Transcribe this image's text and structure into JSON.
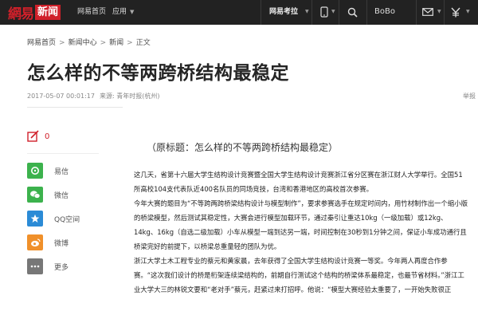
{
  "topbar": {
    "logo_mark": "網易",
    "logo_news": "新闻",
    "nav_home": "网易首页",
    "nav_apps": "应用",
    "kaowei": "网易考拉",
    "user": "BoBo"
  },
  "breadcrumb": [
    "网易首页",
    "新闻中心",
    "新闻",
    "正文"
  ],
  "article": {
    "title": "怎么样的不等两跨桥结构最稳定",
    "date": "2017-05-07 00:01:17",
    "source": "来源: 青年时报(杭州)",
    "report": "举报",
    "lead": "（原标题：怎么样的不等两跨桥结构最稳定）",
    "paragraphs": [
      "这几天，省第十六届大学生结构设计竞赛暨全国大学生结构设计竞赛浙江省分区赛在浙江财人大学举行。全国51所高校104支代表队近400名队员的同场竞技，台湾和香港地区的高校首次参赛。",
      "今年大赛的题目为“不等跨两跨桥梁结构设计与模型制作”，要求参赛选手在规定时间内，用竹材制作出一个缩小版的桥梁模型，然后测试其稳定性，大赛会进行模型加载环节，通过秦引让重达10kg（一级加载）或12kg、14kg、16kg（自选二级加载）小车从模型一端到达另一端，时间控制在30秒到1分钟之间，保证小车成功通行且桥梁完好的前提下，以桥梁总重量轻的团队为优。",
      "浙江大学土木工程专业的蔡元和黄家晨，去年获得了全国大学生结构设计竞赛一等奖。今年两人再度合作参赛。“这次我们设计的桥是桁架连续梁结构的，前期自行测试这个结构的桥梁体系最稳定，也最节省材料。”浙江工业大学大三的林锐文要和“老对手”蔡元，赶紧过来打招呼。他说：“模型大赛经验太重要了，一开始失败很正"
    ]
  },
  "share": {
    "comment_count": "0",
    "items": [
      {
        "label": "易信",
        "icon": "yixin-icon",
        "color": "#3cb24d"
      },
      {
        "label": "微信",
        "icon": "wechat-icon",
        "color": "#3cb24d"
      },
      {
        "label": "QQ空间",
        "icon": "qzone-icon",
        "color": "#2b8bd6"
      },
      {
        "label": "微博",
        "icon": "weibo-icon",
        "color": "#f0902a"
      },
      {
        "label": "更多",
        "icon": "more-icon",
        "color": "#777777"
      }
    ]
  },
  "colors": {
    "brand": "#d0202a",
    "topbar": "#222222"
  }
}
